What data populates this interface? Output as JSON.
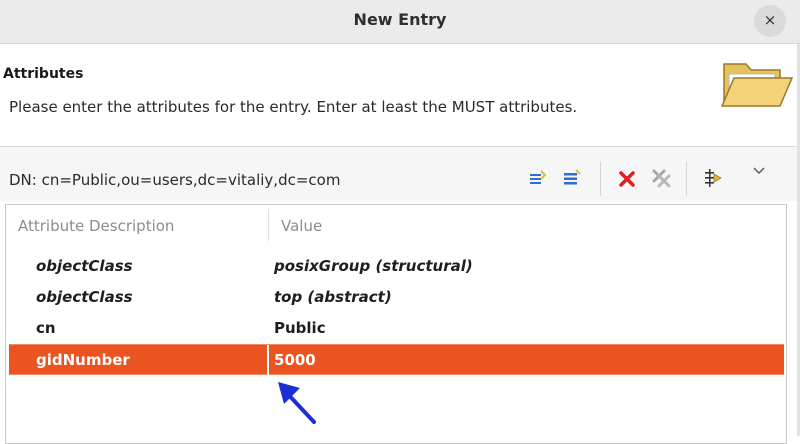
{
  "window": {
    "title": "New Entry",
    "close_glyph": "×"
  },
  "header": {
    "title": "Attributes",
    "description": "Please enter the attributes for the entry. Enter at least the MUST attributes.",
    "icon": "folder-open-icon"
  },
  "dn": {
    "text": "DN: cn=Public,ou=users,dc=vitaliy,dc=com"
  },
  "toolbar": {
    "icons": [
      "new-attribute-icon",
      "new-value-icon",
      "delete-icon",
      "delete-all-icon",
      "edit-value-icon",
      "view-menu-icon"
    ]
  },
  "table": {
    "columns": [
      "Attribute Description",
      "Value"
    ],
    "rows": [
      {
        "attribute": "objectClass",
        "value": "posixGroup (structural)",
        "italic": true,
        "selected": false
      },
      {
        "attribute": "objectClass",
        "value": "top (abstract)",
        "italic": true,
        "selected": false
      },
      {
        "attribute": "cn",
        "value": "Public",
        "italic": false,
        "selected": false
      },
      {
        "attribute": "gidNumber",
        "value": "5000",
        "italic": false,
        "selected": true
      }
    ]
  },
  "colors": {
    "selection": "#e95420",
    "arrow": "#1a2fd6",
    "delete_red": "#e02020",
    "toolbar_blue": "#2f6fd0",
    "toolbar_yellow": "#e8b830"
  }
}
